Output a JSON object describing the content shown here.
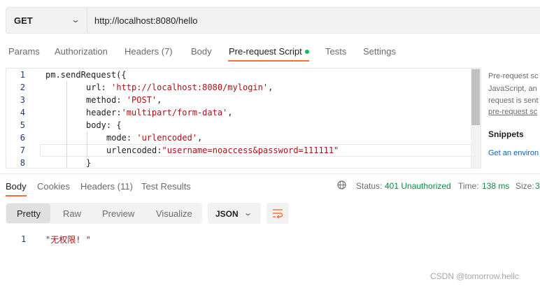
{
  "request": {
    "method": "GET",
    "url": "http://localhost:8080/hello"
  },
  "request_tabs": {
    "params": "Params",
    "authorization": "Authorization",
    "headers": "Headers (7)",
    "body": "Body",
    "pre_request_script": "Pre-request Script",
    "tests": "Tests",
    "settings": "Settings"
  },
  "editor": {
    "line_numbers": [
      "1",
      "2",
      "3",
      "4",
      "5",
      "6",
      "7",
      "8"
    ],
    "line1": "pm.sendRequest({",
    "line2_key": "url: ",
    "line2_val": "'http://localhost:8080/mylogin'",
    "line2_end": ",",
    "line3_key": "method: ",
    "line3_val": "'POST'",
    "line3_end": ",",
    "line4_key": "header:",
    "line4_val": "'multipart/form-data'",
    "line4_end": ",",
    "line5": "body: {",
    "line6_key": "mode: ",
    "line6_val": "'urlencoded'",
    "line6_end": ",",
    "line7_key": "urlencoded:",
    "line7_val": "\"username=noaccess&password=111111\"",
    "line8": "}"
  },
  "side_panel": {
    "line1": "Pre-request sc",
    "line2": "JavaScript, an",
    "line3": "request is sent",
    "line4": "pre-request sc",
    "snippets_title": "Snippets",
    "snippet_link": "Get an environ"
  },
  "response_tabs": {
    "body": "Body",
    "cookies": "Cookies",
    "headers": "Headers (11)",
    "test_results": "Test Results"
  },
  "response_meta": {
    "status_label": "Status:",
    "status_value": "401 Unauthorized",
    "time_label": "Time:",
    "time_value": "138 ms",
    "size_label": "Size:",
    "size_value": "3"
  },
  "view_modes": {
    "pretty": "Pretty",
    "raw": "Raw",
    "preview": "Preview",
    "visualize": "Visualize"
  },
  "format": "JSON",
  "response_body": {
    "line_number": "1",
    "text": "\"无权限! \""
  },
  "watermark": "CSDN @tomorrow.hellc",
  "colors": {
    "accent": "#ff6c37",
    "status_ok_green": "#0b8a3f",
    "string": "#a31515",
    "link": "#0265d2"
  }
}
